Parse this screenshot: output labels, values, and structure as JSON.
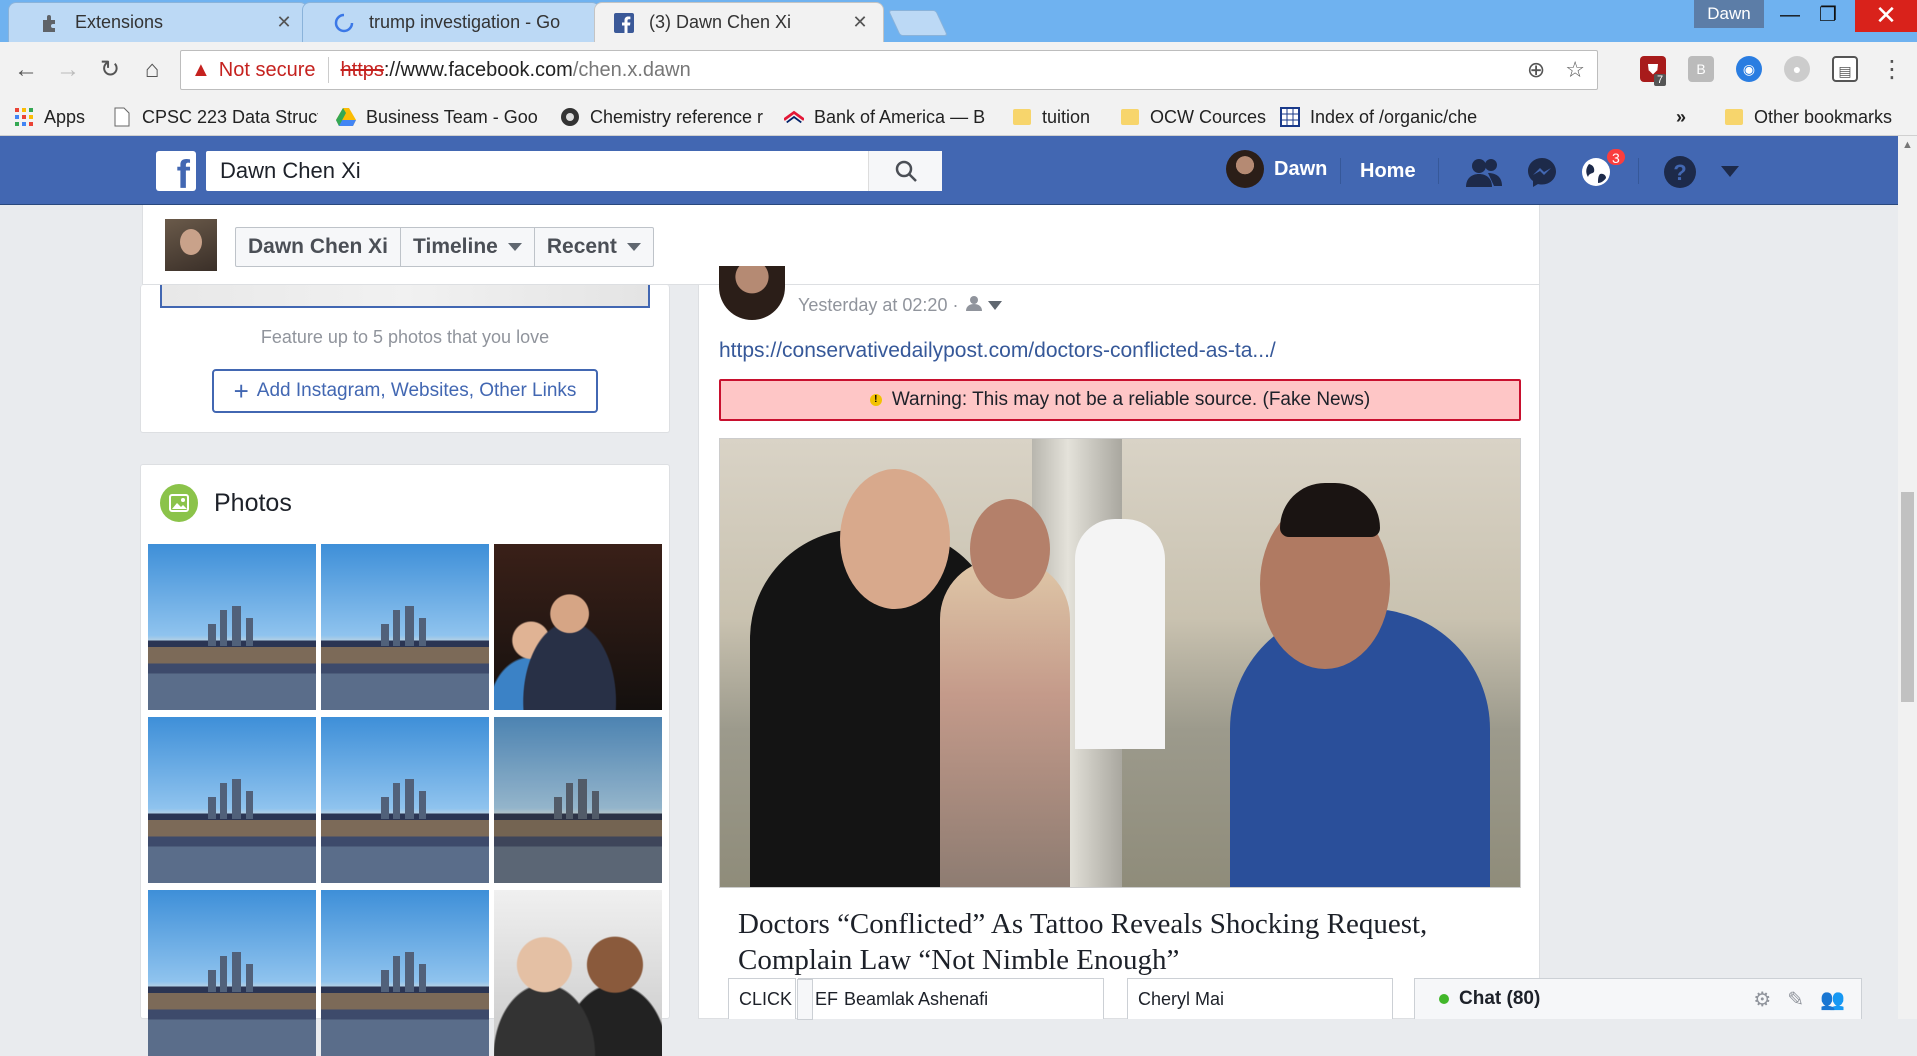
{
  "browser": {
    "tabs": [
      {
        "title": "Extensions",
        "icon": "puzzle-icon",
        "active": false
      },
      {
        "title": "trump investigation - Go",
        "icon": "loading-spinner-icon",
        "active": false
      },
      {
        "title": "(3) Dawn Chen Xi",
        "icon": "facebook-icon",
        "active": true
      }
    ],
    "profile_name": "Dawn",
    "security_label": "Not secure",
    "url_scheme": "https",
    "url_host": "://www.facebook.com",
    "url_path": "/chen.x.dawn",
    "extension_badge": "7",
    "bookmarks": [
      {
        "label": "Apps",
        "icon": "apps-grid-icon"
      },
      {
        "label": "CPSC 223 Data Struct",
        "icon": "page-icon"
      },
      {
        "label": "Business Team - Goo",
        "icon": "google-drive-icon"
      },
      {
        "label": "Chemistry reference r",
        "icon": "site-icon"
      },
      {
        "label": "Bank of America — B",
        "icon": "bank-of-america-icon"
      },
      {
        "label": "tuition",
        "icon": "folder-icon"
      },
      {
        "label": "OCW Cources",
        "icon": "folder-icon"
      },
      {
        "label": "Index of /organic/che",
        "icon": "grid-icon"
      },
      {
        "label": "»",
        "icon": ""
      },
      {
        "label": "Other bookmarks",
        "icon": "folder-icon"
      }
    ]
  },
  "facebook": {
    "search_value": "Dawn Chen Xi",
    "user_name": "Dawn",
    "home_label": "Home",
    "notifications_count": "3"
  },
  "profile": {
    "breadcrumb": [
      "Dawn Chen Xi",
      "Timeline",
      "Recent"
    ],
    "feature_text": "Feature up to 5 photos that you love",
    "add_links_label": "Add Instagram, Websites, Other Links",
    "photos_title": "Photos"
  },
  "post": {
    "timestamp": "Yesterday at 02:20 ·",
    "link": "https://conservativedailypost.com/doctors-conflicted-as-ta.../",
    "warning": "Warning: This may not be a reliable source. (Fake News)",
    "article_title": "Doctors “Conflicted” As Tattoo Reveals Shocking Request, Complain Law “Not Nimble Enough”"
  },
  "chat": {
    "tabs": [
      "CLICK",
      "EF",
      "Beamlak Ashenafi",
      "Cheryl Mai"
    ],
    "main_label": "Chat (80)"
  },
  "colors": {
    "facebook_blue": "#4267b2",
    "warning_bg": "#fec6c6",
    "warning_border": "#c8102e",
    "insecure_red": "#c5221f"
  }
}
